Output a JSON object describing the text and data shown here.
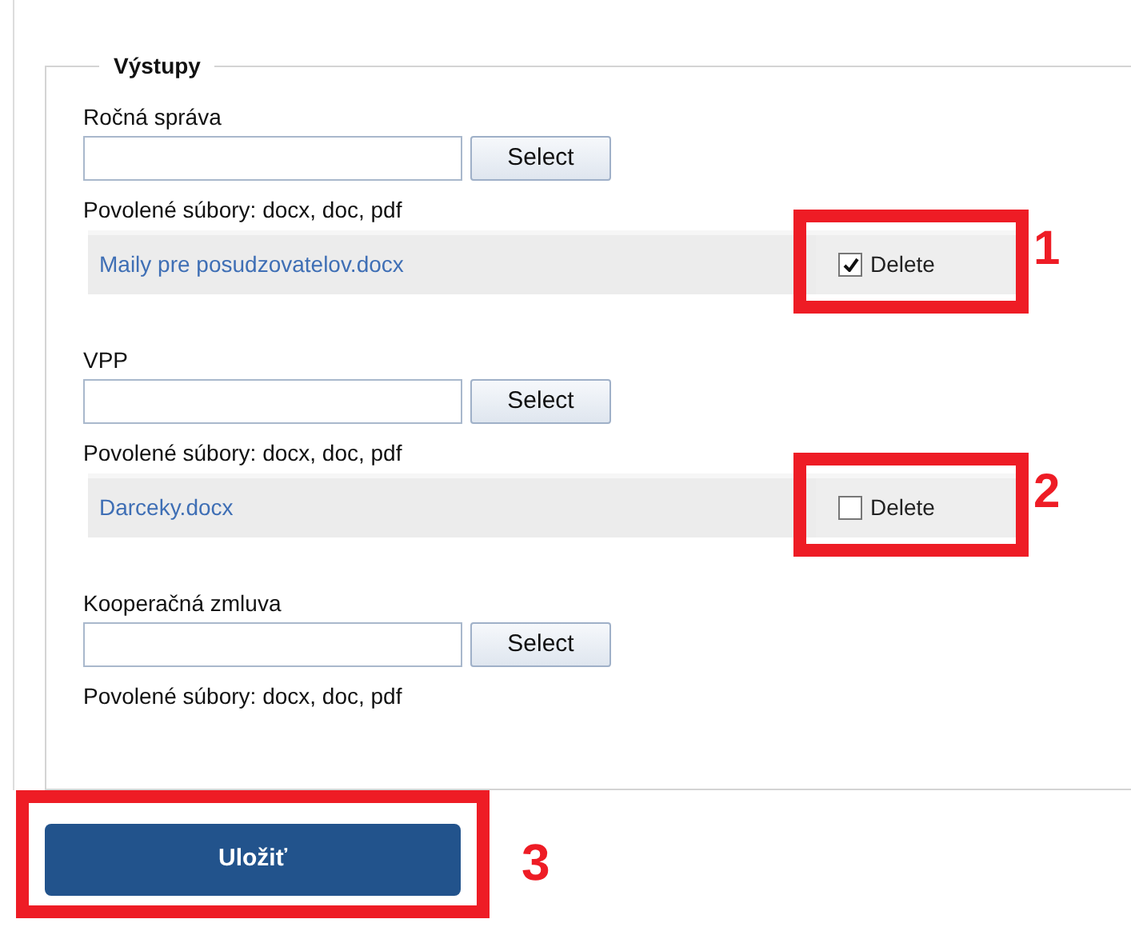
{
  "legend": "Výstupy",
  "sections": [
    {
      "label": "Ročná správa",
      "button": "Select",
      "allowed": "Povolené súbory: docx, doc, pdf",
      "file": {
        "name": "Maily pre posudzovatelov.docx",
        "delete_label": "Delete",
        "checked": true,
        "annotation": "1"
      }
    },
    {
      "label": "VPP",
      "button": "Select",
      "allowed": "Povolené súbory: docx, doc, pdf",
      "file": {
        "name": "Darceky.docx",
        "delete_label": "Delete",
        "checked": false,
        "annotation": "2"
      }
    },
    {
      "label": "Kooperačná zmluva",
      "button": "Select",
      "allowed": "Povolené súbory: docx, doc, pdf"
    }
  ],
  "save": {
    "label": "Uložiť",
    "annotation": "3"
  }
}
